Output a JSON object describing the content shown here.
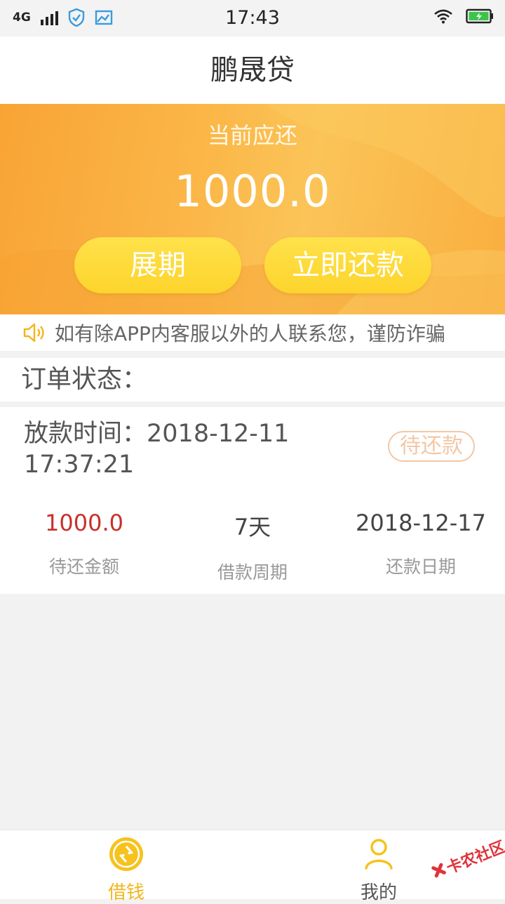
{
  "status_bar": {
    "network": "4G",
    "time": "17:43"
  },
  "header": {
    "title": "鹏晟贷"
  },
  "banner": {
    "label": "当前应还",
    "amount": "1000.0",
    "extend_button": "展期",
    "repay_button": "立即还款"
  },
  "notice": {
    "text": "如有除APP内客服以外的人联系您，谨防诈骗"
  },
  "section": {
    "title": "订单状态："
  },
  "order": {
    "loan_time_label": "放款时间：",
    "loan_time_value": "2018-12-11 17:37:21",
    "status": "待还款",
    "stats": [
      {
        "value": "1000.0",
        "label": "待还金额"
      },
      {
        "value": "7天",
        "label": "借款周期"
      },
      {
        "value": "2018-12-17",
        "label": "还款日期"
      }
    ]
  },
  "tabbar": {
    "tabs": [
      {
        "label": "借钱",
        "icon": "coin-icon",
        "active": true
      },
      {
        "label": "我的",
        "icon": "user-icon",
        "active": false
      }
    ]
  },
  "watermark": {
    "text": "卡农社区"
  },
  "colors": {
    "accent": "#f2b51c",
    "banner": "#fbb748",
    "button": "#fdd42c",
    "amount_red": "#c9302c",
    "status_outline": "#f2c7a6"
  }
}
